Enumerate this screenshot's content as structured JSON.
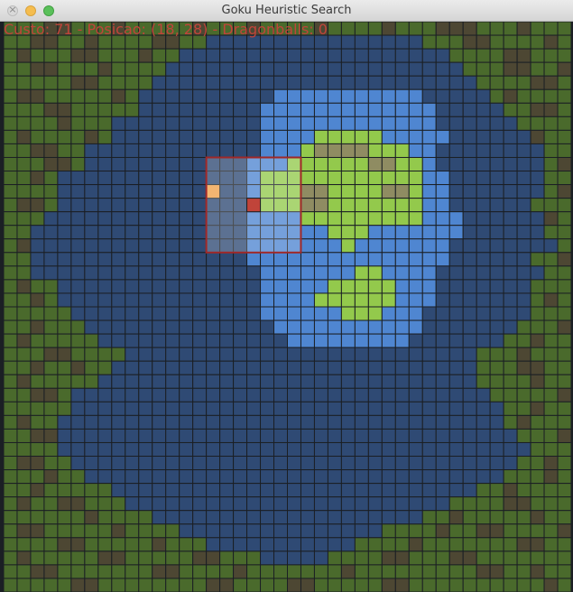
{
  "window": {
    "title": "Goku Heuristic Search"
  },
  "hud": {
    "status_text": "Custo: 71 - Posicao: (18, 28) - Dragonballs: 0",
    "custo": 71,
    "posicao": [
      18,
      28
    ],
    "dragonballs": 0
  },
  "grid": {
    "rows": 42,
    "cols": 42,
    "terrain_legend": {
      "g": "grass",
      "m": "mountain",
      "w": "water",
      "l": "light-water",
      "G": "light-grass",
      "D": "light-mountain"
    },
    "colors": {
      "grass": "#4a6a2c",
      "mountain": "#4d4733",
      "water": "#2f4a74",
      "light-water": "#4f86d1",
      "light-grass": "#93c94c",
      "light-mountain": "#8f8c62",
      "gridline": "#1b1f24",
      "goku": "#c0443a",
      "search-box": "#a02828",
      "search-overlay": "rgba(255,255,255,0.22)",
      "visited": "#f0a04a"
    },
    "terrain": [
      "gggmmgggmgggggmgggmggggmggggmgggmmmgggmggg",
      "ggmmggmggggmmggwwwwwwwwwwwwwwwwgggmmggggmg",
      "gmgggmmgggmggwwwwwwwwwwwwwwwwwwwwggggmmggg",
      "ggmmgggmggggwwwwwwwwwwwwwwwwwwwwwwgggmmggm",
      "gggggmmggggwwwwwwwwwwwwwwwwwwwwwwwwggggmmg",
      "gmmgggggmgwwwwwwwwwwlllllllllllwwwwwgmgggg",
      "gggmmgggggwwwwwwwwwlllllllllllllwwwwwggmmg",
      "ggggmgggwwwwwwwwwwwlllllllllllllwwwwwwgggg",
      "gmggggmgwwwwwwwwwwwllllGGGGGlllllwwwwwwmgg",
      "ggmmggwwwwwwwwwwwwwlllGDDDDGGGllwwwwwwwwgg",
      "gggmmgwwwwwwwwwwwwlllGGGGGGDDGGlwwwwwwwwgm",
      "ggmgwwwwwwwwwwwwwwlGGGGGGGGGGGGllwwwwwwwgg",
      "ggggwwwwwwwwwwwwwwlGGGDDGGGGDDGllwwwwwwwgm",
      "gmmgwwwwwwwwwwwwwwlGGGDDGGGGGGGllwwwwwwggg",
      "gggwwwwwwwwwwwwwwwllllGGGGGGGGGlllwwwwwwmg",
      "ggwwwwwwwwwwwwwwwwllllllGGGlllllllwwwwwwgg",
      "gmwwwwwwwwwwwwwwwwlllllllGlllllllwwwwwwwwg",
      "ggwwwwwwwwwwwwwwwwlllllllllllllllwwwwwwggm",
      "ggwwwwwwwwwwwwwwwwwlllllllGGllllwwwwwwwwgg",
      "gmggwwwwwwwwwwwwwwwlllllGGGGGlllwwwwwwwggg",
      "ggmgwwwwwwwwwwwwwwwllllGGGGGGlllwwwwwwwgmg",
      "gggggwwwwwwwwwwwwwwllllllGGGlllwwwwwwwwggg",
      "ggmgggwwwwwwwwwwwwwwlllllllllllwwwwwwwgggm",
      "gmgggggwwwwwwwwwwwwwwlllllllllwwwwwwwggmgg",
      "gggmmggggwwwwwwwwwwwwwwwwwwwwwwwwwwgggmggg",
      "ggmggmggwwwwwwwwwwwwwwwwwwwwwwwwwwwgggmmgg",
      "gmgggggwwwwwwwwwwwwwwwwwwwwwwwwwwwwggggmgg",
      "ggmmgwwwwwwwwwwwwwwwwwwwwwwwwwwwwwwwgggggm",
      "gggggwwwwwwwwwwwwwwwwwwwwwwwwwwwwwwwwggmgg",
      "gmggwwwwwwwwwwwwwwwwwwwwwwwwwwwwwwwwwgmggg",
      "ggmmwwwwwwwwwwwwwwwwwwwwwwwwwwwwwwwwwwgggm",
      "ggggwwwwwwwwwwwwwwwwwwwwwwwwwwwwwwwwwwwggg",
      "gmmggwwwwwwwwwwwwwwwwwwwwwwwwwwwwwwwwwggmg",
      "gggmggwwwwwwwwwwwwwwwwwwwwwwwwwwwwwwwgggmg",
      "ggmgggggwwwwwwwwwwwwwwwwwwwwwwwwwwwggmgggg",
      "gmggmmgggwwwwwwwwwwwwwwwwwwwwwwwwggggmmggg",
      "ggggggmggggwwwwwwwwwwwwwwwwwwwwggmgggggmgg",
      "gmmgggggmggggwwwwwwwwwwwwwwwggggmggmmggggm",
      "ggggmmgggggmgggwwwwwwwwwwwggggmgggggggmmgg",
      "gmgggggmmgggggmmgggwwwwwggggmmgggmmggggggg",
      "ggmmgggggggmmggggmgggggggmgggggggggmmggmgg",
      "gggggmmggggggggmmggggmmgggggmmggggggggggmg"
    ],
    "search_window": {
      "row": 10,
      "col": 15,
      "rows": 7,
      "cols": 7
    },
    "goku_cell": {
      "row": 13,
      "col": 18
    },
    "visited_cells": [
      {
        "row": 12,
        "col": 15
      }
    ]
  }
}
